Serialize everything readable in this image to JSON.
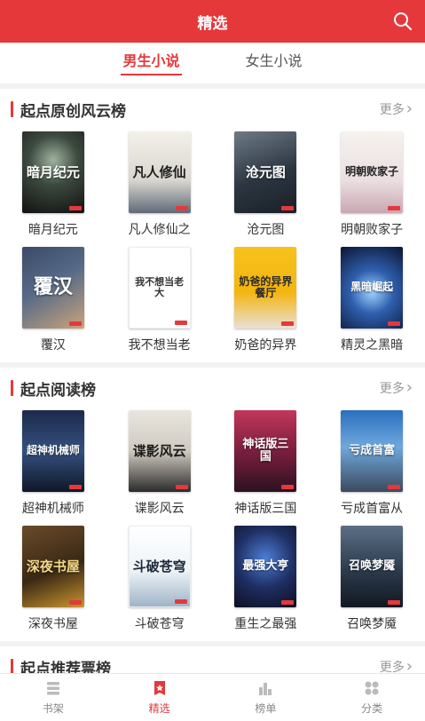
{
  "header": {
    "title": "精选",
    "icon": "search-icon"
  },
  "tabs": [
    {
      "label": "男生小说",
      "active": true
    },
    {
      "label": "女生小说",
      "active": false
    }
  ],
  "sections": [
    {
      "title": "起点原创风云榜",
      "more": "更多",
      "books": [
        {
          "name": "暗月纪元",
          "cover_text": "暗月纪元"
        },
        {
          "name": "凡人修仙之",
          "cover_text": "凡人修仙"
        },
        {
          "name": "沧元图",
          "cover_text": "沧元图"
        },
        {
          "name": "明朝败家子",
          "cover_text": "明朝败家子"
        },
        {
          "name": "覆汉",
          "cover_text": "覆汉"
        },
        {
          "name": "我不想当老",
          "cover_text": "我不想当老大"
        },
        {
          "name": "奶爸的异界",
          "cover_text": "奶爸的异界餐厅"
        },
        {
          "name": "精灵之黑暗",
          "cover_text": "黑暗崛起"
        }
      ]
    },
    {
      "title": "起点阅读榜",
      "more": "更多",
      "books": [
        {
          "name": "超神机械师",
          "cover_text": "超神机械师"
        },
        {
          "name": "谍影风云",
          "cover_text": "谍影风云"
        },
        {
          "name": "神话版三国",
          "cover_text": "神话版三国"
        },
        {
          "name": "亏成首富从",
          "cover_text": "亏成首富"
        },
        {
          "name": "深夜书屋",
          "cover_text": "深夜书屋"
        },
        {
          "name": "斗破苍穹",
          "cover_text": "斗破苍穹"
        },
        {
          "name": "重生之最强",
          "cover_text": "最强大亨"
        },
        {
          "name": "召唤梦魇",
          "cover_text": "召唤梦魇"
        }
      ]
    },
    {
      "title": "起点推荐票榜",
      "more": "更多",
      "books": []
    }
  ],
  "tabbar": [
    {
      "label": "书架",
      "icon": "bookshelf-icon",
      "active": false
    },
    {
      "label": "精选",
      "icon": "featured-icon",
      "active": true
    },
    {
      "label": "榜单",
      "icon": "ranking-icon",
      "active": false
    },
    {
      "label": "分类",
      "icon": "category-icon",
      "active": false
    }
  ],
  "colors": {
    "accent": "#e5383b"
  }
}
